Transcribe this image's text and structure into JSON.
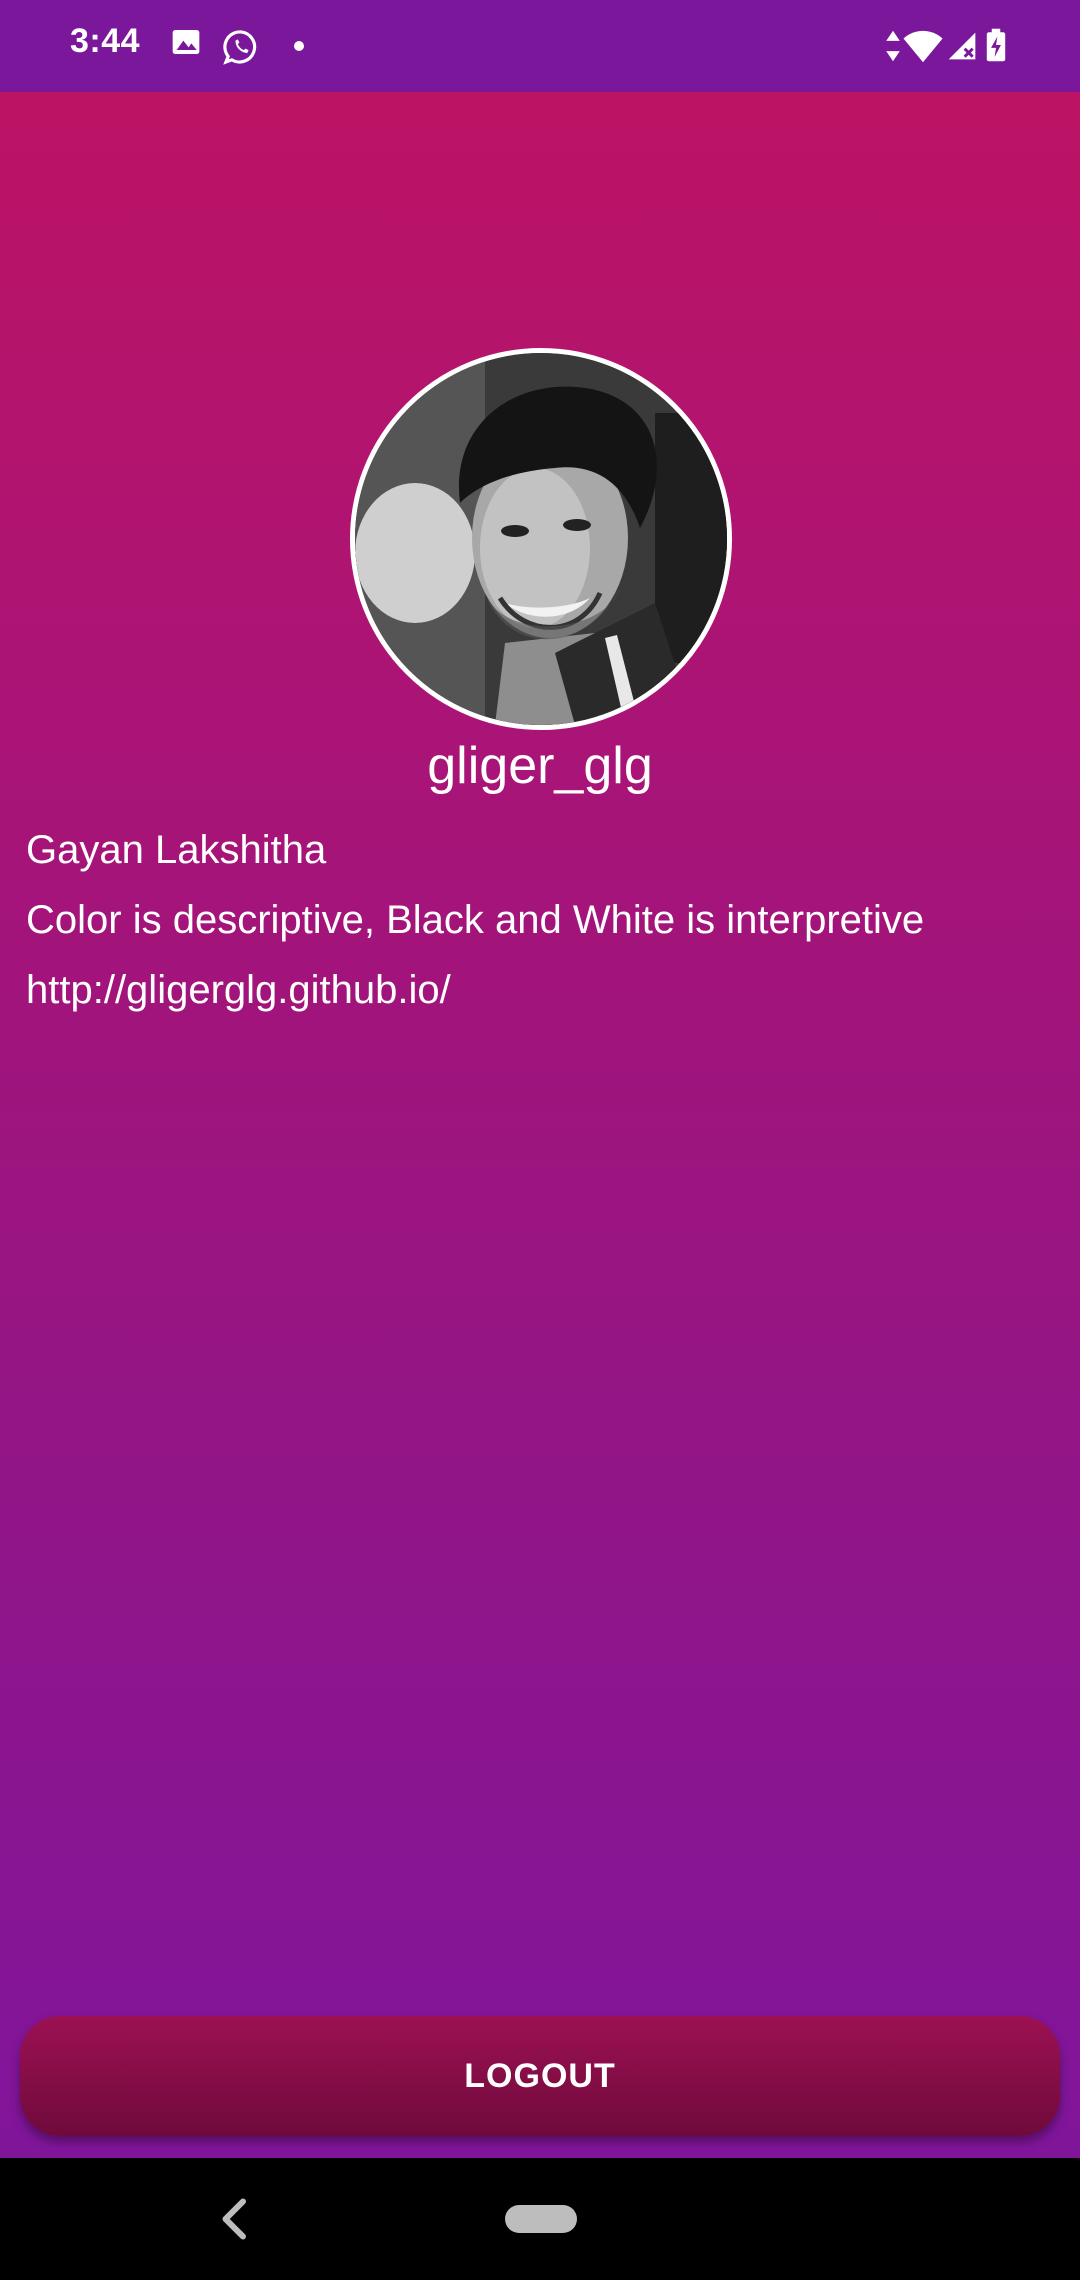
{
  "status_bar": {
    "time": "3:44",
    "icons": [
      "gallery-icon",
      "whatsapp-icon",
      "notification-dot",
      "data-arrows-icon",
      "wifi-icon",
      "cell-signal-icon",
      "battery-charging-icon"
    ]
  },
  "profile": {
    "avatar": "profile-photo",
    "username": "gliger_glg",
    "full_name": "Gayan Lakshitha",
    "bio": "Color is descriptive, Black and White is interpretive",
    "website": "http://gligerglg.github.io/"
  },
  "actions": {
    "logout_label": "LOGOUT"
  },
  "nav_bar": {
    "icons": [
      "back-icon",
      "home-pill"
    ]
  },
  "colors": {
    "status_bar": "#7b179b",
    "gradient_top": "#bf1361",
    "gradient_bottom": "#7e169c",
    "button_top": "#9c1152",
    "button_bottom": "#6f0a3c"
  }
}
